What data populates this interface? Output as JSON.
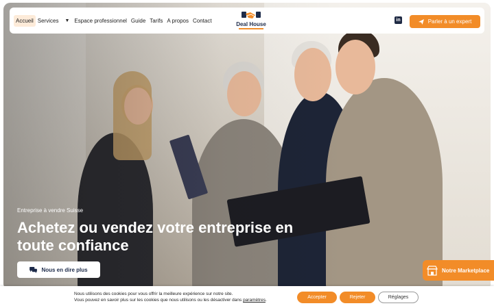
{
  "nav": {
    "items": [
      {
        "label": "Accueil",
        "active": true
      },
      {
        "label": "Services",
        "has_dropdown": true
      },
      {
        "label": "Espace professionnel"
      },
      {
        "label": "Guide"
      },
      {
        "label": "Tarifs"
      },
      {
        "label": "A propos"
      },
      {
        "label": "Contact"
      }
    ],
    "logo_text": "Deal House",
    "social_icon": "linkedin-icon",
    "cta_label": "Parler à un expert",
    "cta_icon": "paper-plane-icon"
  },
  "hero": {
    "kicker": "Entreprise à vendre Suisse",
    "title": "Achetez ou vendez votre entreprise en toute confiance",
    "button_label": "Nous en dire plus",
    "button_icon": "chat-bubbles-icon"
  },
  "marketplace": {
    "label": "Notre Marketplace",
    "icon": "store-icon"
  },
  "cookie": {
    "line1": "Nous utilisons des cookies pour vous offrir la meilleure expérience sur notre site.",
    "line2_prefix": "Vous pouvez en savoir plus sur les cookies que nous utilisons ou les désactiver dans",
    "line2_link": "paramètres",
    "line2_suffix": ".",
    "accept_label": "Accepter",
    "reject_label": "Rejeter",
    "settings_label": "Réglages"
  },
  "colors": {
    "accent": "#f28c28",
    "brand_dark": "#1d2b4a"
  }
}
